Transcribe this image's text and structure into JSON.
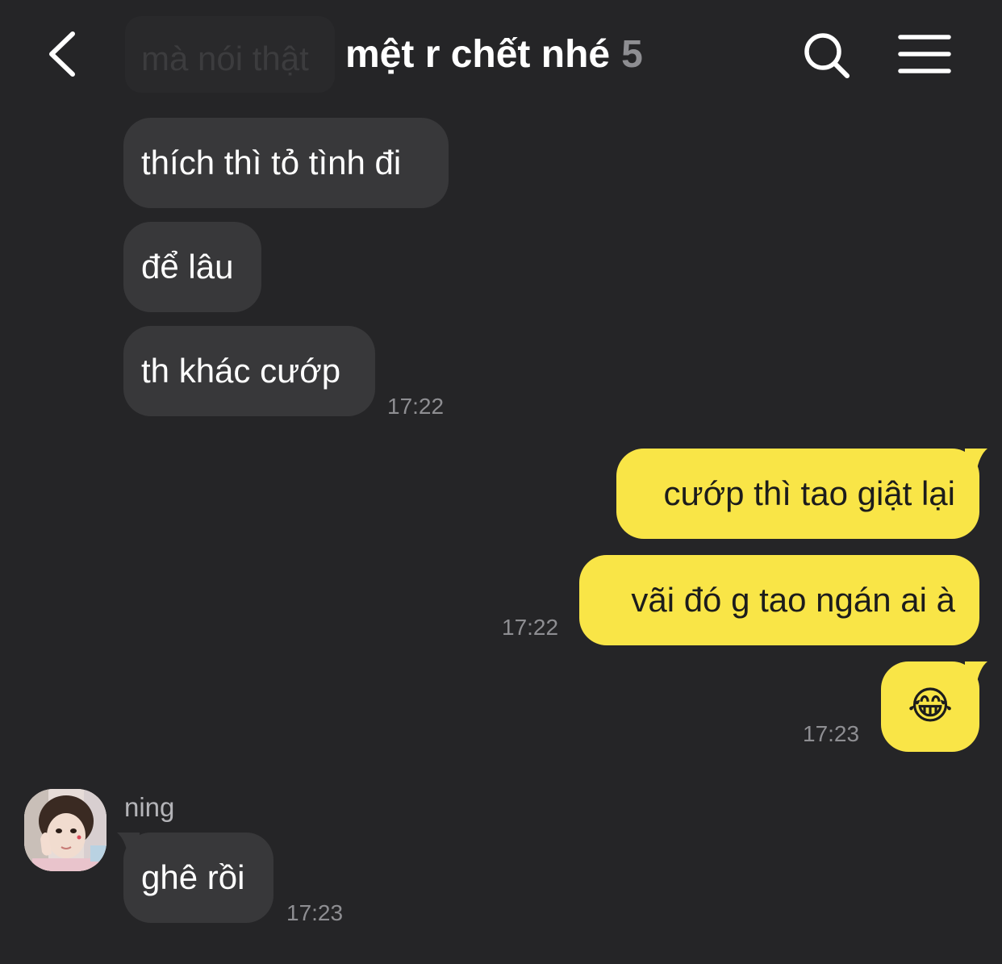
{
  "header": {
    "faded_preview": "mà nói thật",
    "title": "mệt r chết nhé",
    "member_count": "5",
    "back_icon": "chevron-left-icon",
    "search_icon": "search-icon",
    "menu_icon": "hamburger-menu-icon"
  },
  "messages": {
    "m1": {
      "text": "thích thì tỏ tình đi"
    },
    "m2": {
      "text": "để lâu"
    },
    "m3": {
      "text": "th khác cướp",
      "time": "17:22"
    },
    "m4": {
      "text": "cướp thì tao giật lại"
    },
    "m5": {
      "text": "vãi đó g tao ngán ai à",
      "time": "17:22"
    },
    "m6": {
      "text": "😂",
      "time": "17:23"
    },
    "m7": {
      "sender": "ning",
      "text": "ghê rồi",
      "time": "17:23"
    }
  },
  "colors": {
    "background": "#252527",
    "incoming_bubble": "#38383a",
    "outgoing_bubble": "#f9e547",
    "timestamp": "#8e8e92"
  }
}
